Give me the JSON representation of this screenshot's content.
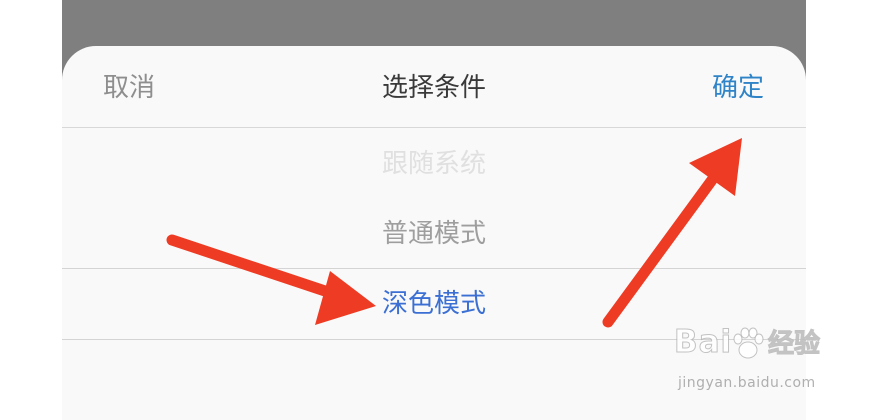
{
  "sheet": {
    "cancel_label": "取消",
    "title": "选择条件",
    "confirm_label": "确定"
  },
  "picker": {
    "options": [
      "跟随系统",
      "普通模式",
      "深色模式"
    ],
    "selected": "深色模式"
  },
  "watermark": {
    "logo_text": "Bai",
    "logo_cn": "经验",
    "url": "jingyan.baidu.com"
  },
  "colors": {
    "confirm": "#2f83c7",
    "selected_option": "#3b6fd4",
    "arrow": "#ee3b24",
    "overlay": "#7f7f7f",
    "sheet_bg": "#f9f9f9"
  },
  "icons": {
    "annotation_arrows": "red-arrow-icon",
    "watermark_paw": "baidu-paw-icon"
  }
}
